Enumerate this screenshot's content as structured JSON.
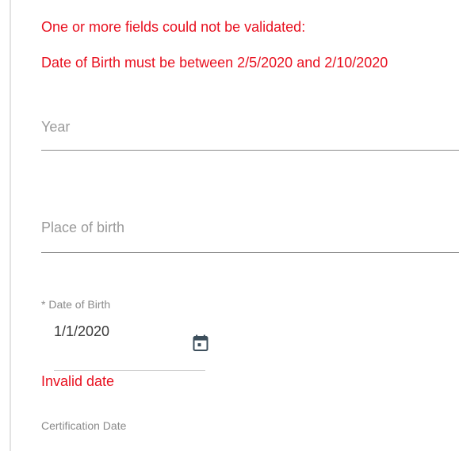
{
  "validation": {
    "heading": "One or more fields could not be validated:",
    "errors": [
      "Date of Birth must be between 2/5/2020 and 2/10/2020"
    ]
  },
  "fields": {
    "year": {
      "placeholder": "Year",
      "value": ""
    },
    "place_of_birth": {
      "placeholder": "Place of birth",
      "value": ""
    },
    "date_of_birth": {
      "label": "* Date of Birth",
      "value": "1/1/2020",
      "icon": "calendar-icon",
      "error": "Invalid date"
    },
    "certification_date": {
      "label": "Certification Date"
    }
  },
  "colors": {
    "error": "#e8101f",
    "icon": "#3d4f5c"
  }
}
